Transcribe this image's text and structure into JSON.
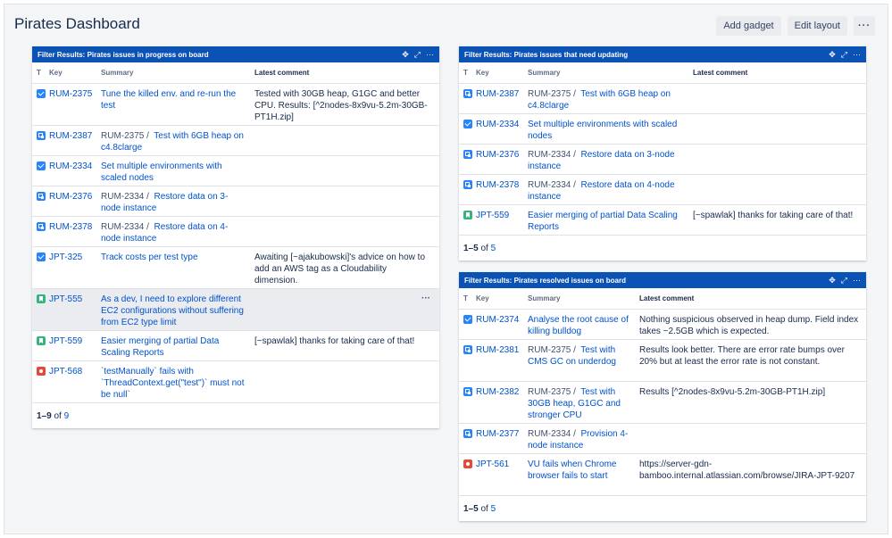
{
  "page": {
    "title": "Pirates Dashboard",
    "actions": {
      "add_gadget": "Add gadget",
      "edit_layout": "Edit layout",
      "more": "···"
    }
  },
  "colors": {
    "header_blue": "#0b52b5",
    "link": "#0052cc",
    "task": "#2684ff",
    "story": "#36b37e",
    "bug": "#e5493a"
  },
  "gadget_icons": {
    "move": "✥",
    "expand": "⤢",
    "more": "···"
  },
  "gadgets": [
    {
      "title": "Filter Results: Pirates issues in progress on board",
      "columns": {
        "t": "T",
        "key": "Key",
        "summary": "Summary",
        "comment": "Latest comment"
      },
      "rows": [
        {
          "type": "task",
          "key": "RUM-2375",
          "parent": "",
          "summary": "Tune the killed env. and re-run the test",
          "comment": "Tested with 30GB heap, G1GC and better CPU. Results: [^2nodes-8x9vu-5.2m-30GB-PT1H.zip]"
        },
        {
          "type": "subtask",
          "key": "RUM-2387",
          "parent": "RUM-2375 /",
          "summary": "Test with 6GB heap on c4.8clarge",
          "comment": ""
        },
        {
          "type": "task",
          "key": "RUM-2334",
          "parent": "",
          "summary": "Set multiple environments with scaled nodes",
          "comment": ""
        },
        {
          "type": "subtask",
          "key": "RUM-2376",
          "parent": "RUM-2334 /",
          "summary": "Restore data on 3-node instance",
          "comment": ""
        },
        {
          "type": "subtask",
          "key": "RUM-2378",
          "parent": "RUM-2334 /",
          "summary": "Restore data on 4-node instance",
          "comment": ""
        },
        {
          "type": "task",
          "key": "JPT-325",
          "parent": "",
          "summary": "Track costs per test type",
          "comment": "Awaiting [~ajakubowski]'s advice on how to add an AWS tag as a Cloudability dimension."
        },
        {
          "type": "story",
          "key": "JPT-555",
          "parent": "",
          "summary": "As a dev, I need to explore different EC2 configurations without suffering from EC2 type limit",
          "comment": "",
          "more": "···"
        },
        {
          "type": "story",
          "key": "JPT-559",
          "parent": "",
          "summary": "Easier merging of partial Data Scaling Reports",
          "comment": "[~spawlak] thanks for taking care of that!"
        },
        {
          "type": "bug",
          "key": "JPT-568",
          "parent": "",
          "summary": "`testManually` fails with `ThreadContext.get(\"test\")` must not be null`",
          "comment": ""
        }
      ],
      "footer": {
        "range": "1–9",
        "of": "of",
        "total": "9"
      }
    },
    {
      "title": "Filter Results: Pirates issues that need updating",
      "columns": {
        "t": "T",
        "key": "Key",
        "summary": "Summary",
        "comment": "Latest comment"
      },
      "rows": [
        {
          "type": "subtask",
          "key": "RUM-2387",
          "parent": "RUM-2375 /",
          "summary": "Test with 6GB heap on c4.8clarge",
          "comment": ""
        },
        {
          "type": "task",
          "key": "RUM-2334",
          "parent": "",
          "summary": "Set multiple environments with scaled nodes",
          "comment": ""
        },
        {
          "type": "subtask",
          "key": "RUM-2376",
          "parent": "RUM-2334 /",
          "summary": "Restore data on 3-node instance",
          "comment": ""
        },
        {
          "type": "subtask",
          "key": "RUM-2378",
          "parent": "RUM-2334 /",
          "summary": "Restore data on 4-node instance",
          "comment": ""
        },
        {
          "type": "story",
          "key": "JPT-559",
          "parent": "",
          "summary": "Easier merging of partial Data Scaling Reports",
          "comment": "[~spawlak] thanks for taking care of that!"
        }
      ],
      "footer": {
        "range": "1–5",
        "of": "of",
        "total": "5"
      }
    },
    {
      "title": "Filter Results: Pirates resolved issues on board",
      "columns": {
        "t": "T",
        "key": "Key",
        "summary": "Summary",
        "comment": "Latest comment"
      },
      "rows": [
        {
          "type": "task",
          "key": "RUM-2374",
          "parent": "",
          "summary": "Analyse the root cause of killing bulldog",
          "comment": "Nothing suspicious observed in heap dump. Field index takes ~2.5GB which is expected."
        },
        {
          "type": "subtask",
          "key": "RUM-2381",
          "parent": "RUM-2375 /",
          "summary": "Test with CMS GC on underdog",
          "comment": "Results look better. There are error rate bumps over 20% but at least the error rate is not constant."
        },
        {
          "type": "subtask",
          "key": "RUM-2382",
          "parent": "RUM-2375 /",
          "summary": "Test with 30GB heap, G1GC and stronger CPU",
          "comment": "Results [^2nodes-8x9vu-5.2m-30GB-PT1H.zip]"
        },
        {
          "type": "subtask",
          "key": "RUM-2377",
          "parent": "RUM-2334 /",
          "summary": "Provision 4-node instance",
          "comment": ""
        },
        {
          "type": "bug",
          "key": "JPT-561",
          "parent": "",
          "summary": "VU fails when Chrome browser fails to start",
          "comment": "https://server-gdn-bamboo.internal.atlassian.com/browse/JIRA-JPT-9207"
        }
      ],
      "footer": {
        "range": "1–5",
        "of": "of",
        "total": "5"
      }
    }
  ]
}
